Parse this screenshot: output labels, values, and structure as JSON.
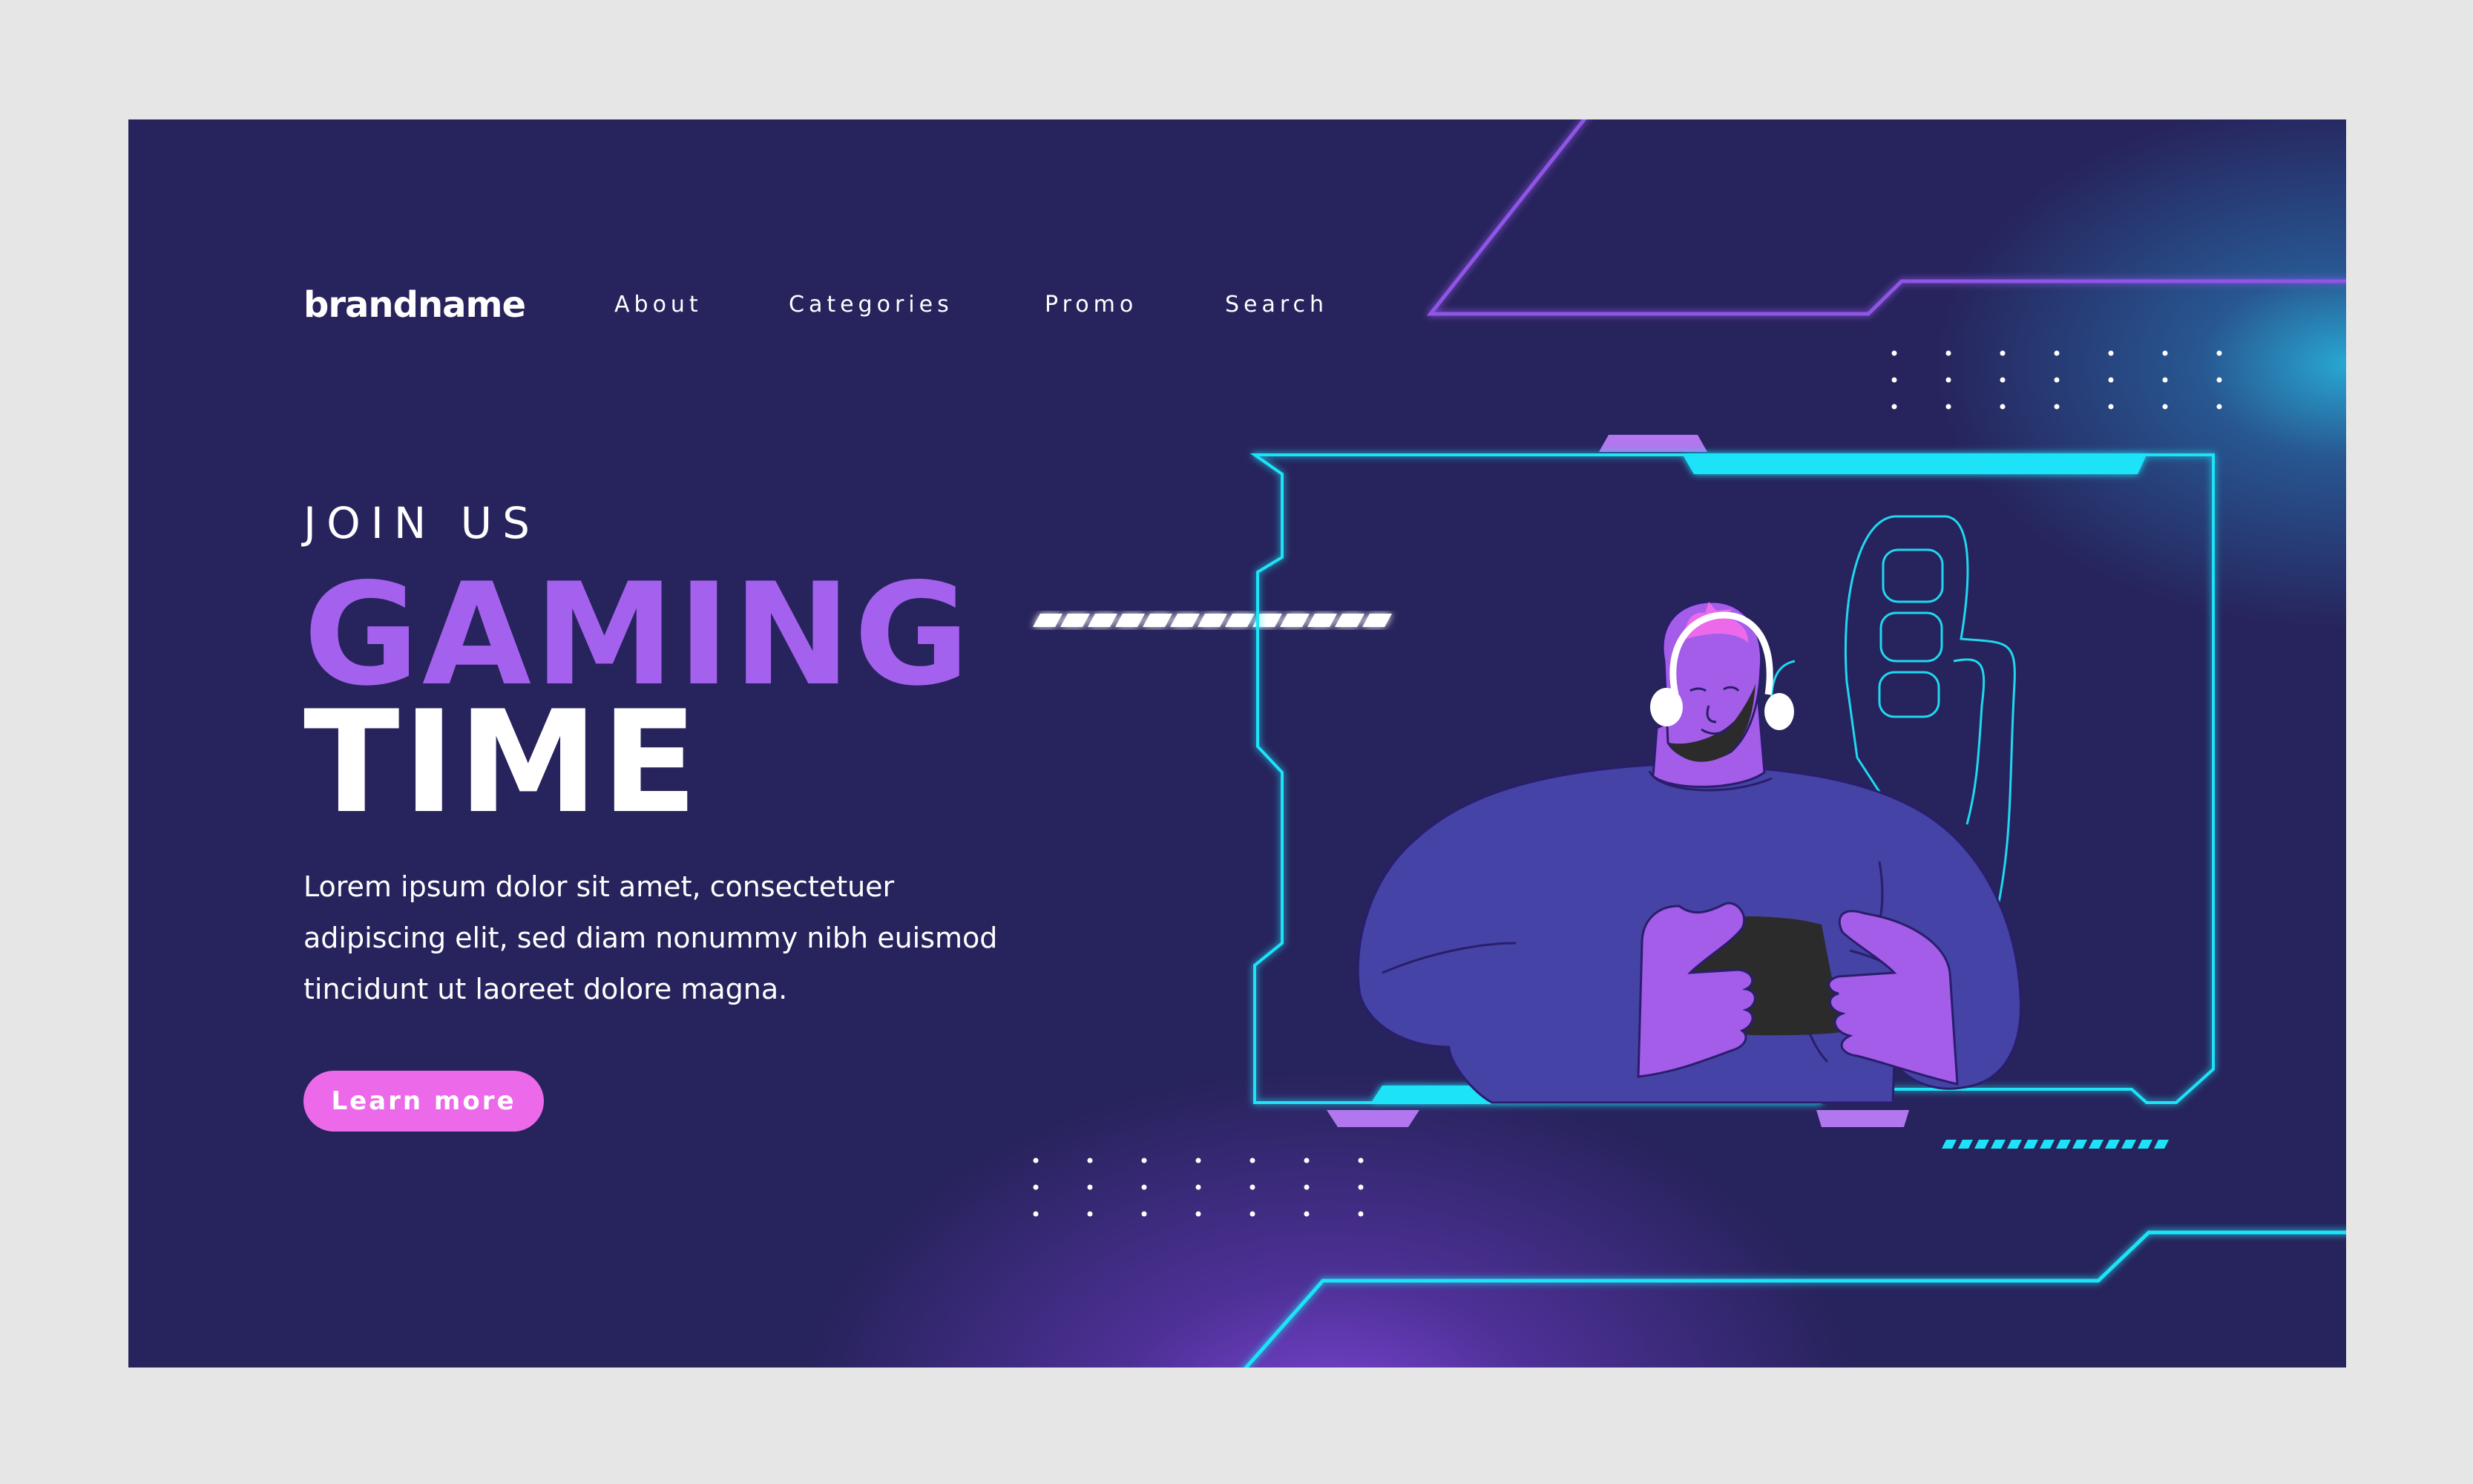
{
  "header": {
    "brand": "brandname",
    "nav": [
      "About",
      "Categories",
      "Promo",
      "Search"
    ]
  },
  "hero": {
    "eyebrow": "JOIN US",
    "title_line1": "GAMING",
    "title_line2": "TIME",
    "description_lines": [
      "Lorem ipsum dolor sit amet, consectetuer",
      "adipiscing elit, sed diam nonummy nibh euismod",
      "tincidunt ut laoreet dolore magna."
    ],
    "cta_label": "Learn more"
  },
  "illustration": {
    "subject": "gamer-with-headphones-holding-controller",
    "frame": "neon-hud-frame"
  },
  "colors": {
    "background": "#27235c",
    "page": "#e6e6e7",
    "accent_purple": "#a461ee",
    "accent_pink": "#ec6ae9",
    "neon_cyan": "#1ee3f7",
    "neon_violet": "#8f55e6",
    "sweater": "#4543a5",
    "skin": "#a35de9"
  }
}
